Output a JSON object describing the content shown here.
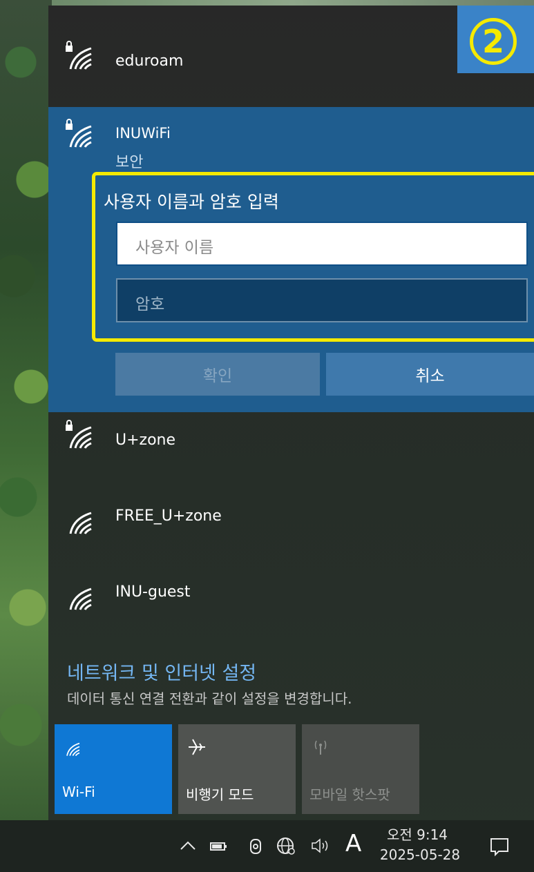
{
  "networks": {
    "eduroam": {
      "name": "eduroam",
      "secured": true
    },
    "active": {
      "name": "INUWiFi",
      "status": "보안",
      "credentials_title": "사용자 이름과 암호 입력",
      "username_placeholder": "사용자 이름",
      "password_placeholder": "암호",
      "ok_label": "확인",
      "cancel_label": "취소"
    },
    "uzone": {
      "name": "U+zone",
      "secured": true
    },
    "free_uzone": {
      "name": "FREE_U+zone",
      "secured": false
    },
    "inu_guest": {
      "name": "INU-guest",
      "secured": false
    }
  },
  "annotation": {
    "step": "2"
  },
  "settings": {
    "link_label": "네트워크 및 인터넷 설정",
    "description": "데이터 통신 연결 전환과 같이 설정을 변경합니다."
  },
  "quick_actions": {
    "wifi": {
      "label": "Wi-Fi",
      "active": true
    },
    "airplane": {
      "label": "비행기 모드",
      "active": false
    },
    "mobile_hotspot": {
      "label": "모바일 핫스팟",
      "enabled": false
    }
  },
  "taskbar": {
    "ime_indicator": "A",
    "time": "오전 9:14",
    "date": "2025-05-28"
  },
  "colors": {
    "accent": "#0f78d4",
    "highlight": "#f5ea00",
    "link": "#74b6f2"
  }
}
